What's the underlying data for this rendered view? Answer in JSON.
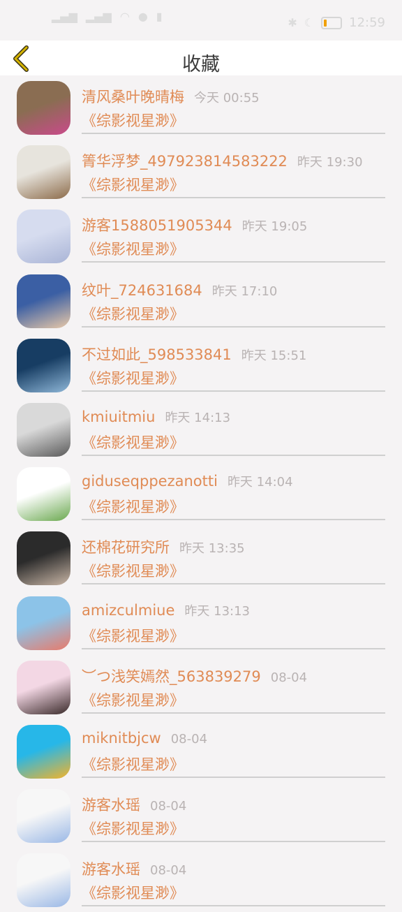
{
  "status_bar": {
    "time": "12:59",
    "battery_icon": "battery-icon",
    "signal_icon": "signal-icon",
    "wifi_icon": "wifi-icon"
  },
  "header": {
    "title": "收藏",
    "back_icon": "chevron-left-icon",
    "accent_color": "#d6b400"
  },
  "items": [
    {
      "name": "清风桑叶晚晴梅",
      "time": "今天 00:55",
      "work": "《综影视星渺》",
      "avatar_colors": [
        "#8a6d52",
        "#c94a8a"
      ]
    },
    {
      "name": "箐华浮梦_497923814583222",
      "time": "昨天 19:30",
      "work": "《综影视星渺》",
      "avatar_colors": [
        "#e7e4dd",
        "#8c6b4a"
      ]
    },
    {
      "name": "游客1588051905344",
      "time": "昨天 19:05",
      "work": "《综影视星渺》",
      "avatar_colors": [
        "#d6dcef",
        "#a9b4d6"
      ]
    },
    {
      "name": "纹叶_724631684",
      "time": "昨天 17:10",
      "work": "《综影视星渺》",
      "avatar_colors": [
        "#3b5fa4",
        "#e9c9a8"
      ]
    },
    {
      "name": "不过如此_598533841",
      "time": "昨天 15:51",
      "work": "《综影视星渺》",
      "avatar_colors": [
        "#173d63",
        "#8fb7d8"
      ]
    },
    {
      "name": "kmiuitmiu",
      "time": "昨天 14:13",
      "work": "《综影视星渺》",
      "avatar_colors": [
        "#d9d9d9",
        "#5a5a5a"
      ]
    },
    {
      "name": "giduseqppezanotti",
      "time": "昨天 14:04",
      "work": "《综影视星渺》",
      "avatar_colors": [
        "#ffffff",
        "#6aa84f"
      ]
    },
    {
      "name": "还棉花研究所",
      "time": "昨天 13:35",
      "work": "《综影视星渺》",
      "avatar_colors": [
        "#2b2b2b",
        "#c9b6a6"
      ]
    },
    {
      "name": "amizculmiue",
      "time": "昨天 13:13",
      "work": "《综影视星渺》",
      "avatar_colors": [
        "#8cc3e8",
        "#e87a6a"
      ]
    },
    {
      "name": "︶つ浅笑嫣然_563839279",
      "time": "08-04",
      "work": "《综影视星渺》",
      "avatar_colors": [
        "#f3d7e4",
        "#3a2a2a"
      ]
    },
    {
      "name": "miknitbjcw",
      "time": "08-04",
      "work": "《综影视星渺》",
      "avatar_colors": [
        "#27b7e8",
        "#f3b32a"
      ]
    },
    {
      "name": "游客水瑶",
      "time": "08-04",
      "work": "《综影视星渺》",
      "avatar_colors": [
        "#f7f7f7",
        "#9ab8e6"
      ]
    },
    {
      "name": "游客水瑶",
      "time": "08-04",
      "work": "《综影视星渺》",
      "avatar_colors": [
        "#f7f7f7",
        "#9ab8e6"
      ]
    }
  ]
}
